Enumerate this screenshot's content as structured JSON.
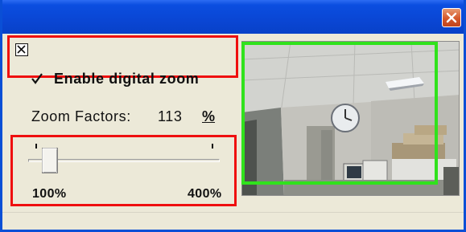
{
  "titlebar": {
    "close_icon": "close-icon"
  },
  "panel": {
    "enable_digital_zoom": {
      "label": "Enable digital zoom",
      "checked": true
    },
    "zoom_factors": {
      "label": "Zoom Factors:",
      "value": "113",
      "unit": "%"
    },
    "slider": {
      "min_label": "100%",
      "max_label": "400%",
      "value_percent": 113
    }
  },
  "preview": {
    "scene": "office-ceiling-with-clock"
  },
  "colors": {
    "highlight_red": "#ef0f0f",
    "highlight_green": "#30e21c",
    "title_blue": "#0a46d4",
    "window_bg": "#ece9d8",
    "close_orange": "#d5582a"
  }
}
